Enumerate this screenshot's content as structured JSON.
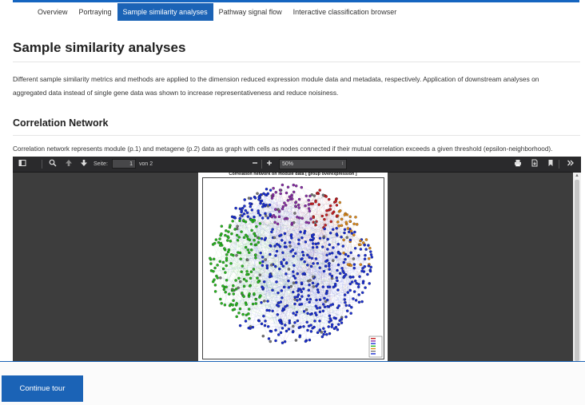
{
  "nav": {
    "tabs": [
      {
        "label": "Overview"
      },
      {
        "label": "Portraying"
      },
      {
        "label": "Sample similarity analyses",
        "active": true
      },
      {
        "label": "Pathway signal flow"
      },
      {
        "label": "Interactive classification browser"
      }
    ]
  },
  "page": {
    "title": "Sample similarity analyses",
    "intro": "Different sample similarity metrics and methods are applied to the dimension reduced expression module data and metadata, respectively. Application of downstream analyses on aggregated data instead of single gene data was shown to increase representativeness and reduce noisiness."
  },
  "section": {
    "title": "Correlation Network",
    "description": "Correlation network represents module (p.1) and metagene (p.2) data as graph with cells as nodes connected if their mutual correlation exceeds a given threshold (epsilon-neighborhood)."
  },
  "pdf_viewer": {
    "page_label": "Seite:",
    "page_value": "1",
    "page_total": "von 2",
    "zoom_value": "50%",
    "document_title": "Correlation network on module data [ group overexpression ]",
    "icons": [
      "sidebar-toggle-icon",
      "search-icon",
      "previous-page-icon",
      "next-page-icon",
      "zoom-out-icon",
      "zoom-in-icon",
      "print-icon",
      "download-icon",
      "bookmark-icon",
      "tools-icon"
    ],
    "cluster_colors": {
      "blue": "#1a2fd6",
      "green": "#27b81f",
      "red": "#c81f24",
      "orange": "#e08a19",
      "purple": "#8a2fa8",
      "gray": "#777777"
    }
  },
  "footer": {
    "continue_label": "Continue tour"
  }
}
